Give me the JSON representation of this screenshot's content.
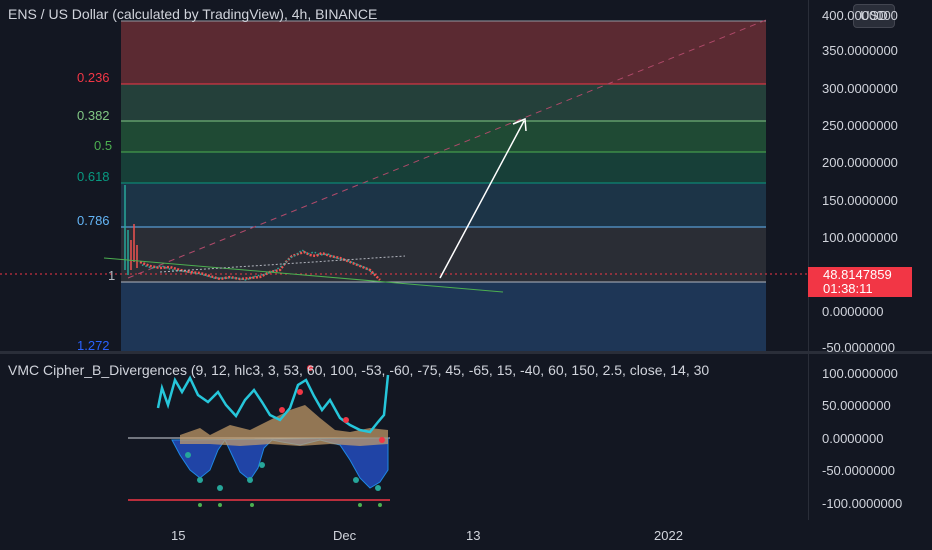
{
  "header": {
    "title": "ENS / US Dollar (calculated by TradingView), 4h, BINANCE",
    "currency": "USD"
  },
  "fib_levels": [
    {
      "label": "0.236",
      "color": "#f23645"
    },
    {
      "label": "0.382",
      "color": "#81c784"
    },
    {
      "label": "0.5",
      "color": "#4caf50"
    },
    {
      "label": "0.618",
      "color": "#089981"
    },
    {
      "label": "0.786",
      "color": "#64b5f6"
    },
    {
      "label": "1",
      "color": "#b2b5be"
    },
    {
      "label": "1.272",
      "color": "#2962ff"
    }
  ],
  "price_axis": [
    "400.0000000",
    "350.0000000",
    "300.0000000",
    "250.0000000",
    "200.0000000",
    "150.0000000",
    "100.0000000",
    "0.0000000",
    "-50.0000000"
  ],
  "last_price": {
    "value": "48.8147859",
    "countdown": "01:38:11"
  },
  "indicator": {
    "title": "VMC Cipher_B_Divergences (9, 12, hlc3, 3, 53, 60, 100, -53, -60, -75, 45, -65, 15, -40, 60, 150, 2.5, close, 14, 30",
    "axis": [
      "100.0000000",
      "50.0000000",
      "0.0000000",
      "-50.0000000",
      "-100.0000000"
    ]
  },
  "time_axis": [
    "15",
    "Dec",
    "13",
    "2022"
  ]
}
